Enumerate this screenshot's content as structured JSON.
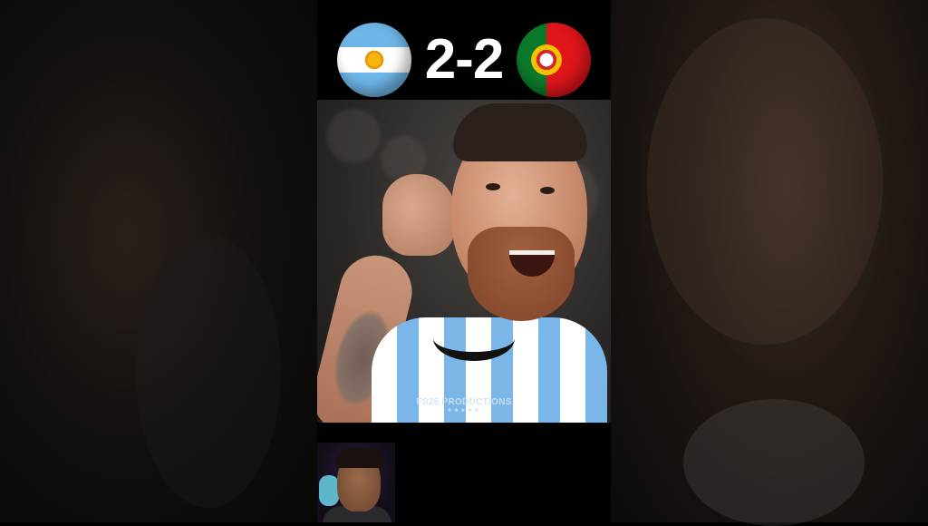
{
  "scoreboard": {
    "home_flag": "argentina-flag-icon",
    "away_flag": "portugal-flag-icon",
    "score": "2-2"
  },
  "video": {
    "watermark": "FS25 PRODUCTIONS",
    "watermark_stars": "★★★★★"
  },
  "colors": {
    "argentina_blue": "#6fb6e8",
    "portugal_green": "#0a7a2a",
    "portugal_red": "#e0161b",
    "score_text": "#ffffff"
  }
}
